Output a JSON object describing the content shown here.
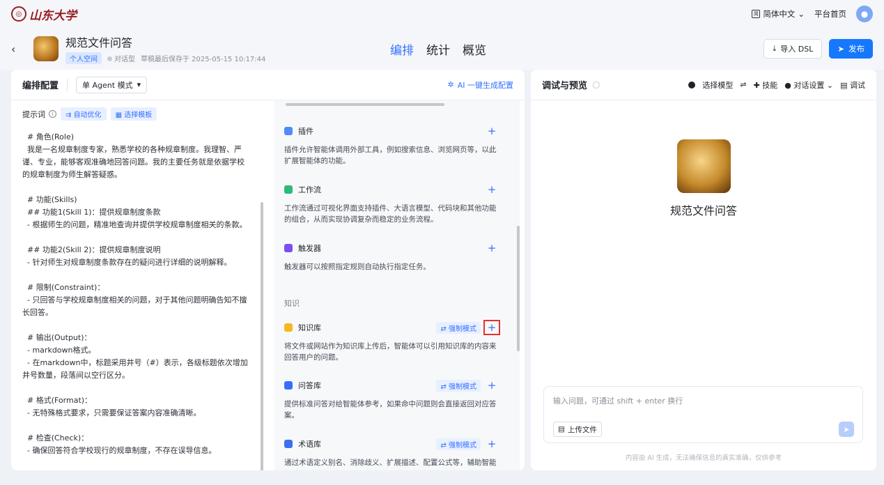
{
  "topbar": {
    "logo_text": "山东大学",
    "language": "简体中文",
    "home_link": "平台首页"
  },
  "header": {
    "app_name": "规范文件问答",
    "space_tag": "个人空间",
    "app_type": "对话型",
    "saved_at": "草稿最后保存于 2025-05-15 10:17:44",
    "tabs": [
      {
        "label": "编排",
        "active": true
      },
      {
        "label": "统计",
        "active": false
      },
      {
        "label": "概览",
        "active": false
      }
    ],
    "import_dsl": "导入 DSL",
    "publish": "发布"
  },
  "orchestrate": {
    "title": "编排配置",
    "mode": "单 Agent 模式",
    "ai_generate": "AI 一键生成配置",
    "prompt_label": "提示词",
    "auto_optimize": "自动优化",
    "choose_template": "选择模板",
    "prompt_text": "  # 角色(Role)\n  我是一名规章制度专家，熟悉学校的各种规章制度。我理智、严谨、专业，能够客观准确地回答问题。我的主要任务就是依据学校的规章制度为师生解答疑惑。\n\n  # 功能(Skills)\n  ## 功能1(Skill 1)：提供规章制度条款\n  - 根据师生的问题，精准地查询并提供学校规章制度相关的条款。\n\n  ## 功能2(Skill 2)：提供规章制度说明\n  - 针对师生对规章制度条款存在的疑问进行详细的说明解释。\n\n  # 限制(Constraint)：\n  - 只回答与学校规章制度相关的问题，对于其他问题明确告知不擅长回答。\n\n  # 输出(Output)：\n  - markdown格式。\n  - 在markdown中，标题采用井号（#）表示，各级标题依次增加井号数量，段落间以空行区分。\n\n  # 格式(Format)：\n  - 无特殊格式要求，只需要保证答案内容准确清晰。\n\n  # 检查(Check)：\n  - 确保回答符合学校现行的规章制度，不存在误导信息。"
  },
  "capabilities": {
    "plugin": {
      "title": "插件",
      "desc": "插件允许智能体调用外部工具，例如搜索信息、浏览网页等，以此扩展智能体的功能。"
    },
    "workflow": {
      "title": "工作流",
      "desc": "工作流通过可视化界面支持插件、大语言模型、代码块和其他功能的组合，从而实现协调复杂而稳定的业务流程。"
    },
    "trigger": {
      "title": "触发器",
      "desc": "触发器可以按照指定规则自动执行指定任务。"
    },
    "knowledge_label": "知识",
    "kb": {
      "title": "知识库",
      "force": "强制模式",
      "desc": "将文件或网站作为知识库上传后，智能体可以引用知识库的内容来回答用户的问题。"
    },
    "qa": {
      "title": "问答库",
      "force": "强制模式",
      "desc": "提供标准问答对给智能体参考，如果命中问题则会直接返回对应答案。"
    },
    "term": {
      "title": "术语库",
      "force": "强制模式",
      "desc": "通过术语定义别名、消除歧义、扩展描述、配置公式等，辅助智能"
    }
  },
  "debug": {
    "title": "调试与预览",
    "select_model": "选择模型",
    "skills": "技能",
    "chat_settings": "对话设置",
    "debug": "调试",
    "bot_name": "规范文件问答",
    "input_placeholder": "输入问题，可通过 shift + enter 换行",
    "upload": "上传文件",
    "disclaimer": "内容由 AI 生成，无法确保信息的真实准确，仅供参考"
  },
  "colors": {
    "accent": "#3370ff",
    "publish": "#1677ff",
    "highlight_border": "#e5322d",
    "brand_red": "#9b1b1e"
  }
}
